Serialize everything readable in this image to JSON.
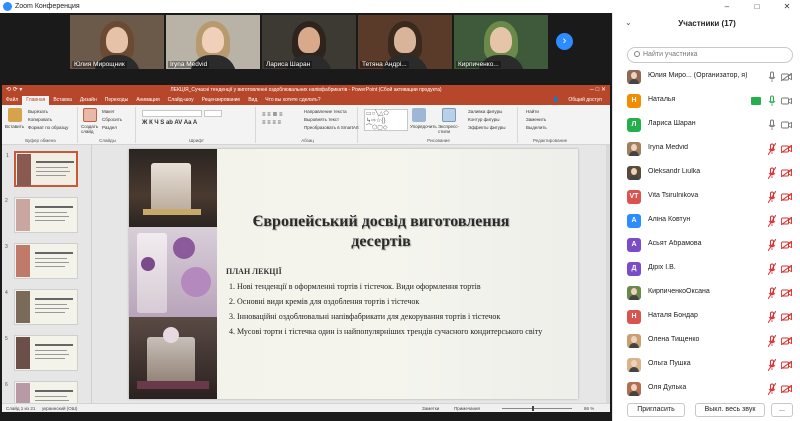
{
  "window": {
    "title": "Zoom Конференция",
    "controls": [
      "–",
      "□",
      "✕"
    ]
  },
  "video_strip": {
    "tiles": [
      {
        "name": "Юлия Мирощник",
        "bg": "#6b5a4a",
        "skin": "#e6c2a8",
        "hair": "#6a4a32"
      },
      {
        "name": "Iryna Medvid",
        "bg": "#b9b2a6",
        "skin": "#f0d0bb",
        "hair": "#b79a6e"
      },
      {
        "name": "Лариса Шаран",
        "bg": "#3d3a33",
        "skin": "#d9a98c",
        "hair": "#2e241d"
      },
      {
        "name": "Тетяна Андрі...",
        "bg": "#5a3a28",
        "skin": "#d9b49a",
        "hair": "#3a2a1e"
      },
      {
        "name": "Кирпиченко...",
        "bg": "#3e5a3a",
        "skin": "#e6c4a8",
        "hair": "#6a8a4a"
      }
    ],
    "next_label": "›"
  },
  "ppt": {
    "title": "ЛЕКЦІЯ_Сучасні тенденції у виготовленні оздоблювальних напівфабрикатів - PowerPoint (Сбой активации продукта)",
    "qat": "⟲ ⟳ ▾",
    "win_controls": "─ □ ✕",
    "tabs": [
      "Файл",
      "Главная",
      "Вставка",
      "Дизайн",
      "Переходы",
      "Анимация",
      "Слайд-шоу",
      "Рецензирование",
      "Вид",
      "Что вы хотите сделать?"
    ],
    "active_tab": "Главная",
    "share": "Общий доступ",
    "ribbon": {
      "clipboard_label": "Буфер обмена",
      "paste": "Вставить",
      "cut": "Вырезать",
      "copy": "Копировать",
      "format_painter": "Формат по образцу",
      "slides_label": "Слайды",
      "new_slide": "Создать слайд",
      "layout": "Макет",
      "reset": "Сбросить",
      "section": "Раздел",
      "font_label": "Шрифт",
      "paragraph_label": "Абзац",
      "text_direction": "Направление текста",
      "align_text": "Выровнять текст",
      "smartart": "Преобразовать в SmartArt",
      "drawing_label": "Рисование",
      "arrange": "Упорядочить",
      "quick_styles": "Экспресс-стили",
      "shape_fill": "Заливка фигуры",
      "shape_outline": "Контур фигуры",
      "shape_effects": "Эффекты фигуры",
      "editing_label": "Редактирование",
      "find": "Найти",
      "replace": "Заменить",
      "select": "Выделить"
    },
    "slide": {
      "title": "Європейський досвід виготовлення десертів",
      "plan": "ПЛАН ЛЕКЦІЇ",
      "items": [
        "1. Нові тенденції в оформленні тортів і тістечок. Види оформлення тортів",
        " 2. Основні види кремів для оздоблення тортів і тістечок",
        "3. Інноваційні оздоблювальні напівфабрикати для декорування тортів і тістечок",
        "4. Мусові торти і тістечка один із найпопулярніших трендів сучасного кондитерського світу"
      ]
    },
    "thumb_numbers": [
      "1",
      "2",
      "3",
      "4",
      "5",
      "6"
    ],
    "status": {
      "slide": "Слайд 1 из 21",
      "language": "украинский (ОШ)",
      "notes": "Заметки",
      "comments": "Примечания",
      "zoom": "86 %"
    }
  },
  "participants": {
    "header": "Участники (17)",
    "search_placeholder": "Найти участника",
    "list": [
      {
        "name": "Юлия Миро...  (Организатор, я)",
        "initial": "",
        "color": "#8c6a55",
        "photo": true,
        "mic": "on",
        "cam": "off-gray",
        "share": false
      },
      {
        "name": "Наталья",
        "initial": "Н",
        "color": "#f28c00",
        "photo": false,
        "mic": "on-green",
        "cam": "on",
        "share": true
      },
      {
        "name": "Лариса Шаран",
        "initial": "Л",
        "color": "#23b04a",
        "photo": false,
        "mic": "on",
        "cam": "on",
        "share": false
      },
      {
        "name": "Iryna Medvid",
        "initial": "",
        "color": "#a08060",
        "photo": true,
        "mic": "muted",
        "cam": "off",
        "share": false
      },
      {
        "name": "Oleksandr Liulka",
        "initial": "",
        "color": "#5a4a3a",
        "photo": true,
        "mic": "muted",
        "cam": "off",
        "share": false
      },
      {
        "name": "Vita Tsirulnikova",
        "initial": "VT",
        "color": "#d9534f",
        "photo": false,
        "mic": "muted",
        "cam": "off",
        "share": false
      },
      {
        "name": "Аліна Ковтун",
        "initial": "А",
        "color": "#2d8cff",
        "photo": false,
        "mic": "muted",
        "cam": "off",
        "share": false
      },
      {
        "name": "Асьят Абрамова",
        "initial": "А",
        "color": "#7b4cc7",
        "photo": false,
        "mic": "muted",
        "cam": "off",
        "share": false
      },
      {
        "name": "Дірiх I.B.",
        "initial": "Д",
        "color": "#7b4cc7",
        "photo": false,
        "mic": "muted",
        "cam": "off",
        "share": false
      },
      {
        "name": "КирпиченкоОксана",
        "initial": "",
        "color": "#6a8a4a",
        "photo": true,
        "mic": "muted",
        "cam": "off",
        "share": false
      },
      {
        "name": "Наталя Бондар",
        "initial": "Н",
        "color": "#d9534f",
        "photo": false,
        "mic": "muted",
        "cam": "off",
        "share": false
      },
      {
        "name": "Олена Тищенко",
        "initial": "",
        "color": "#c9a070",
        "photo": true,
        "mic": "muted",
        "cam": "off",
        "share": false
      },
      {
        "name": "Ольга Пушка",
        "initial": "",
        "color": "#d8b48a",
        "photo": true,
        "mic": "muted",
        "cam": "off",
        "share": false
      },
      {
        "name": "Оля Дулька",
        "initial": "",
        "color": "#b07050",
        "photo": true,
        "mic": "muted",
        "cam": "off",
        "share": false
      }
    ],
    "invite": "Пригласить",
    "mute_all": "Выкл. весь звук",
    "more": "..."
  },
  "colors": {
    "zoom_blue": "#2d8cff",
    "ppt_red": "#b7472a",
    "muted_red": "#e02828"
  }
}
